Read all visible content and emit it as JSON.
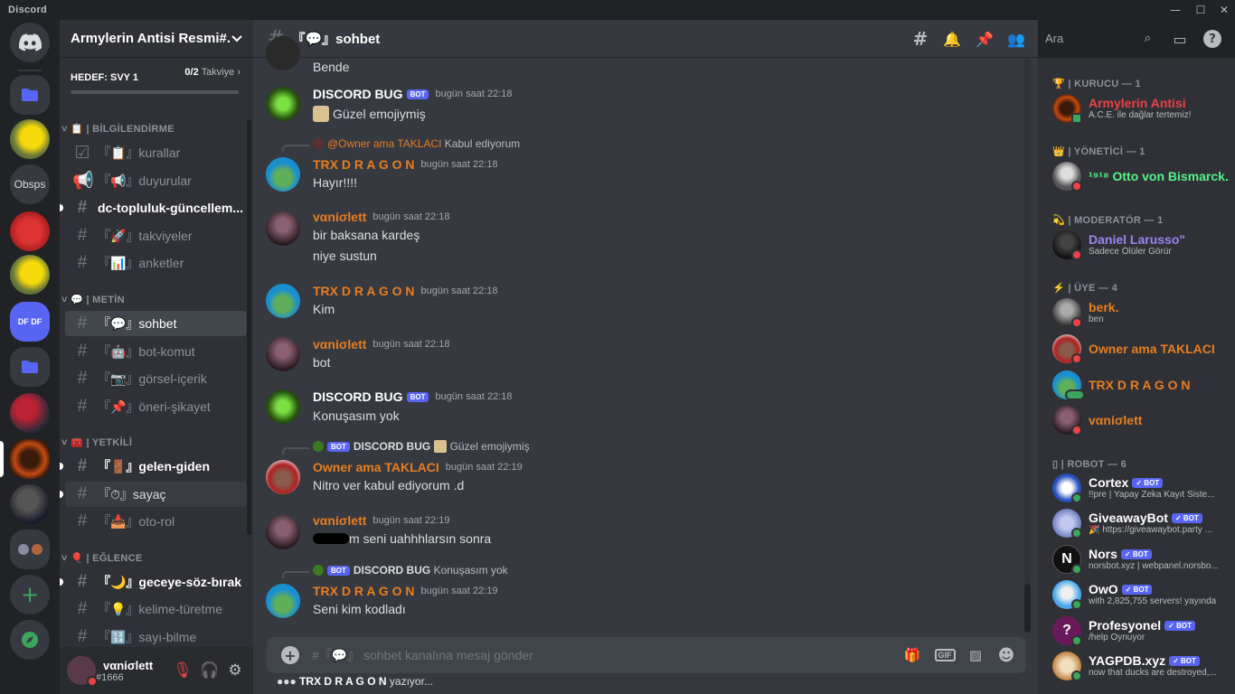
{
  "app": {
    "name": "Discord"
  },
  "window": {
    "minimize": "—",
    "maximize": "☐",
    "close": "✕"
  },
  "rail": {
    "obsps_label": "Obsps",
    "df_label": "DF DF"
  },
  "guild": {
    "name": "Armylerin Antisi Resmi#...",
    "boost_goal": "HEDEF: SVY 1",
    "boost_count": "0/2",
    "boost_label": "Takviye",
    "boost_progress": 0
  },
  "categories": [
    {
      "label": "📋 | BİLGİLENDİRME"
    },
    {
      "label": "💬 | METİN"
    },
    {
      "label": "🧰 | YETKİLİ"
    },
    {
      "label": "🎈 | EĞLENCE"
    }
  ],
  "channels": [
    {
      "label": "『📋』kurallar"
    },
    {
      "label": "『📢』duyurular"
    },
    {
      "label": "dc-topluluk-güncellem..."
    },
    {
      "label": "『🚀』takviyeler"
    },
    {
      "label": "『📊』anketler"
    },
    {
      "label": "『💬』sohbet"
    },
    {
      "label": "『🤖』bot-komut"
    },
    {
      "label": "『📷』görsel-içerik"
    },
    {
      "label": "『📌』öneri-şikayet"
    },
    {
      "label": "『🚪』gelen-giden"
    },
    {
      "label": "『⏱』sayaç"
    },
    {
      "label": "『📥』oto-rol"
    },
    {
      "label": "『🌙』geceye-söz-bırak"
    },
    {
      "label": "『💡』kelime-türetme"
    },
    {
      "label": "『🔢』sayı-bilme"
    }
  ],
  "user": {
    "name": "vαnίσlett",
    "tag": "#1666"
  },
  "chat": {
    "channel_title": "『💬』sohbet",
    "composer_placeholder": "#『💬』 sohbet kanalına mesaj gönder",
    "typing_user": "TRX D R A G O N",
    "typing_suffix": "yazıyor...",
    "top_text": "Bende",
    "bot_label": "BOT",
    "messages": [
      {
        "author": "DISCORD BUG",
        "time": "bugün saat 22:18",
        "text": "Güzel emojiymiş"
      },
      {
        "reply_user": "@Owner ama TAKLACI",
        "reply_text": "Kabul ediyorum",
        "author": "TRX   D R A G O N",
        "time": "bugün saat 22:18",
        "text": "Hayır!!!!"
      },
      {
        "author": "vαnίσlett",
        "time": "bugün saat 22:18",
        "text": "bir baksana kardeş",
        "text2": "niye sustun"
      },
      {
        "author": "TRX   D R A G O N",
        "time": "bugün saat 22:18",
        "text": "Kim"
      },
      {
        "author": "vαnίσlett",
        "time": "bugün saat 22:18",
        "text": "bot"
      },
      {
        "author": "DISCORD BUG",
        "time": "bugün saat 22:18",
        "text": "Konuşasım yok"
      },
      {
        "reply_user": "DISCORD BUG",
        "reply_text": "Güzel emojiymiş",
        "author": "Owner ama TAKLACI",
        "time": "bugün saat 22:19",
        "text": "Nitro ver kabul ediyorum .d"
      },
      {
        "author": "vαnίσlett",
        "time": "bugün saat 22:19",
        "text": "m seni uahhhlarsın sonra"
      },
      {
        "reply_user": "DISCORD BUG",
        "reply_text": "Konuşasım yok",
        "author": "TRX   D R A G O N",
        "time": "bugün saat 22:19",
        "text": "Seni kim kodladı"
      }
    ]
  },
  "search": {
    "placeholder": "Ara"
  },
  "members": {
    "groups": [
      {
        "label": "🏆 | KURUCU — 1"
      },
      {
        "label": "👑 | YÖNETİCİ — 1"
      },
      {
        "label": "💫 | MODERATÖR — 1"
      },
      {
        "label": "⚡ | ÜYE — 4"
      },
      {
        "label": "▯ | ROBOT — 6"
      }
    ],
    "list": [
      {
        "name": "Armylerin Antisi",
        "activity": "A.C.E. ile dağlar tertemiz!",
        "color": "#ed4245"
      },
      {
        "name": "¹⁹¹⁸ Otto von Bismarck...",
        "activity": "",
        "color": "#57f287"
      },
      {
        "name": "Daniel Larusso\"",
        "activity": "Sadece Ölüler Görür",
        "color": "#9b84ee"
      },
      {
        "name": "berk.",
        "activity": "ben",
        "color": "#e67e22"
      },
      {
        "name": "Owner ama TAKLACI",
        "activity": "",
        "color": "#e67e22"
      },
      {
        "name": "TRX D R A G O N",
        "activity": "",
        "color": "#e67e22"
      },
      {
        "name": "vαnίσlett",
        "activity": "",
        "color": "#e67e22"
      },
      {
        "name": "Cortex",
        "activity": "!!pre | Yapay Zeka Kayıt Siste...",
        "color": "#ffffff"
      },
      {
        "name": "GiveawayBot",
        "activity": "🎉 https://giveawaybot.party ...",
        "color": "#ffffff"
      },
      {
        "name": "Nors",
        "activity": "norsbot.xyz | webpanel.norsbo...",
        "color": "#ffffff"
      },
      {
        "name": "OwO",
        "activity": "with 2,825,755 servers! yayında",
        "color": "#ffffff"
      },
      {
        "name": "Profesyonel",
        "activity": "/help Oynuyor",
        "color": "#ffffff"
      },
      {
        "name": "YAGPDB.xyz",
        "activity": "now that ducks are destroyed,...",
        "color": "#ffffff"
      }
    ],
    "verified_bot_label": "✓ BOT"
  },
  "colors": {
    "orange": "#e67e22",
    "white": "#ffffff",
    "blurple": "#5865f2",
    "online": "#3ba55c",
    "dnd": "#ed4245"
  }
}
